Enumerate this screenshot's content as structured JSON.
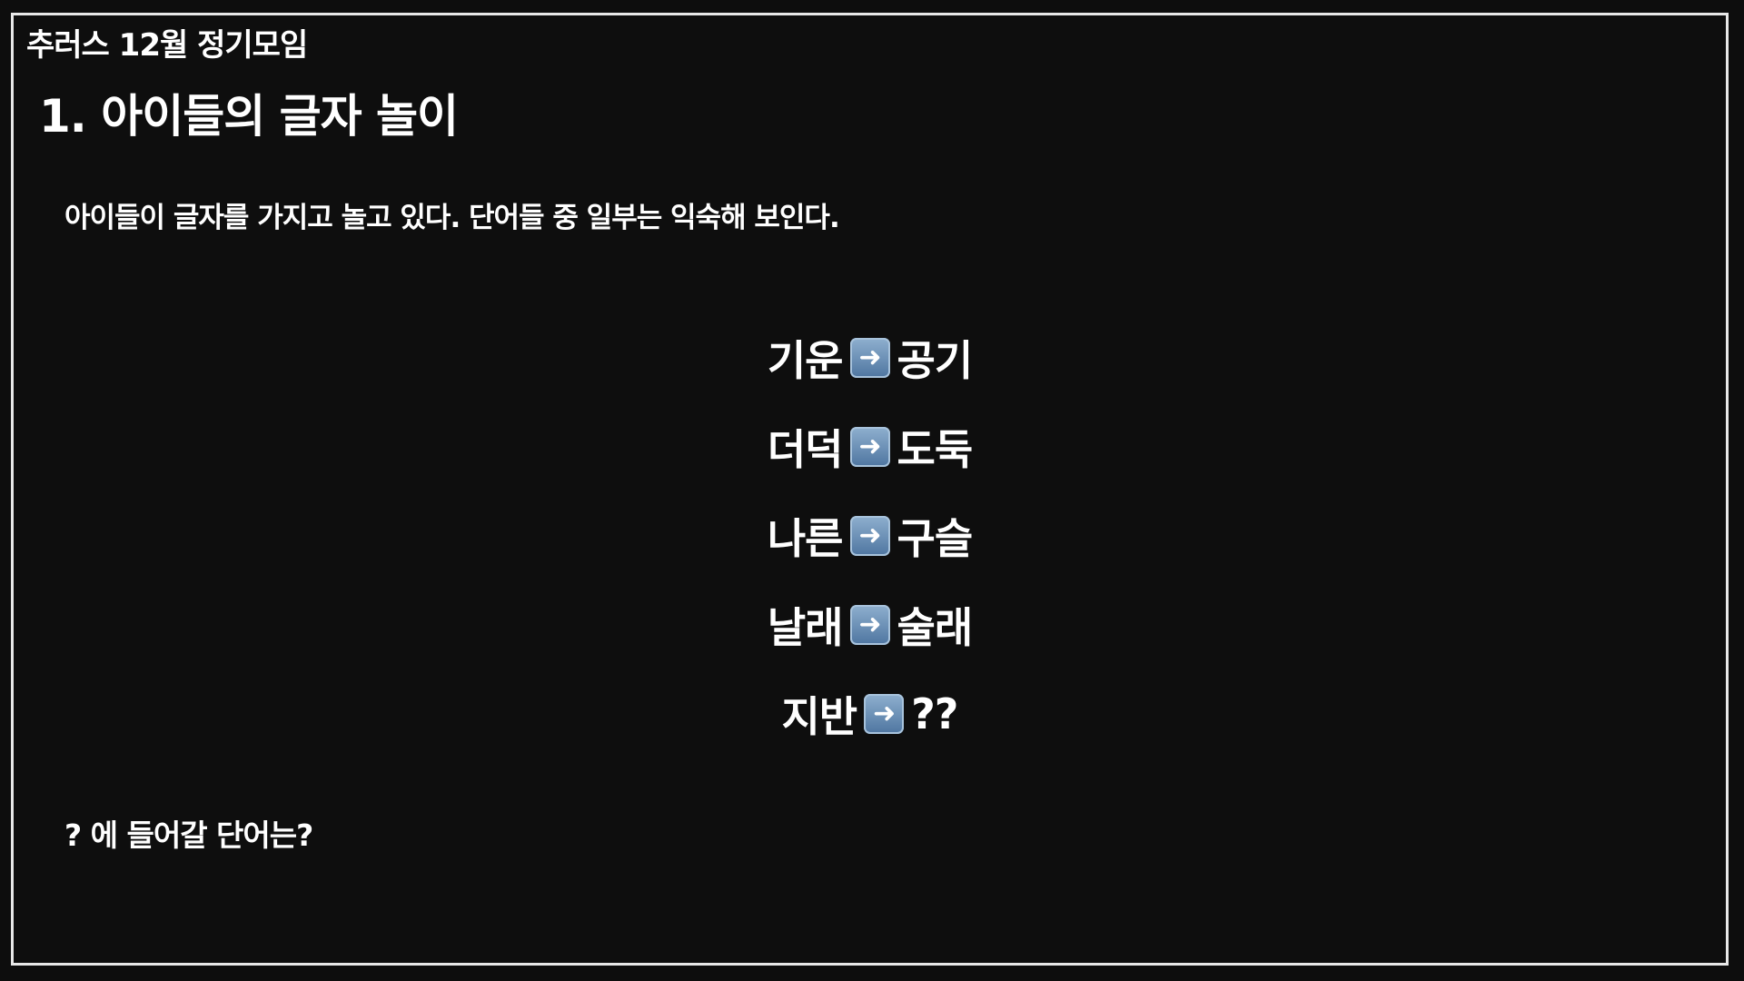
{
  "meeting_title": "추러스 12월 정기모임",
  "section_title": "1. 아이들의 글자 놀이",
  "intro": "아이들이 글자를 가지고 놀고 있다. 단어들 중 일부는 익숙해 보인다.",
  "pairs": [
    {
      "left": "기운",
      "right": "공기"
    },
    {
      "left": "더덕",
      "right": "도둑"
    },
    {
      "left": "나른",
      "right": "구슬"
    },
    {
      "left": "날래",
      "right": "술래"
    },
    {
      "left": "지반",
      "right": "??"
    }
  ],
  "arrow_icon": "right-arrow-icon",
  "arrow_glyph": "➜",
  "question": "? 에 들어갈 단어는?",
  "colors": {
    "background": "#0e0e0e",
    "border": "#e8e8e8",
    "text": "#ffffff",
    "arrow_badge": "#6f93ba"
  }
}
